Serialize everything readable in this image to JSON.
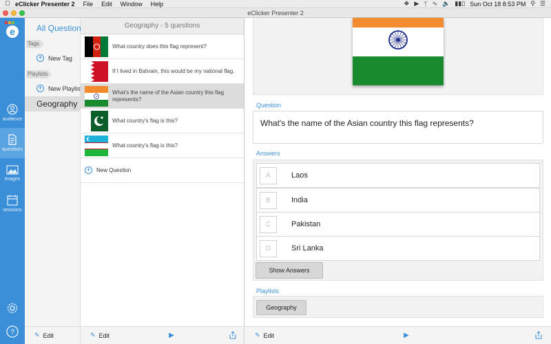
{
  "menubar": {
    "app_name": "eClicker Presenter 2",
    "menus": [
      "File",
      "Edit",
      "Window",
      "Help"
    ],
    "clock": "Sun Oct 18  8:53 PM"
  },
  "window": {
    "title": "eClicker Presenter 2"
  },
  "rail": {
    "items": [
      {
        "label": "audience",
        "icon": "person-icon"
      },
      {
        "label": "questions",
        "icon": "document-icon"
      },
      {
        "label": "images",
        "icon": "image-icon"
      },
      {
        "label": "sessions",
        "icon": "calendar-icon"
      }
    ],
    "accent": "#3a8fd8"
  },
  "library": {
    "all_questions": "All Questions",
    "tags_header": "Tags",
    "new_tag": "New Tag",
    "playlists_header": "Playlists",
    "new_playlist": "New Playlist",
    "selected_playlist": "Geography",
    "edit_label": "Edit"
  },
  "question_list": {
    "header": "Geography - 5 questions",
    "items": [
      {
        "text": "What country does this flag represent?",
        "flag": "afghanistan"
      },
      {
        "text": "If I lived in Bahrain, this would be my national flag.",
        "flag": "bahrain"
      },
      {
        "text": "What's the name of the Asian country this flag represents?",
        "flag": "india",
        "selected": true
      },
      {
        "text": "What country's flag is this?",
        "flag": "pakistan"
      },
      {
        "text": "What country's flag is this?",
        "flag": "uzbekistan"
      }
    ],
    "new_question": "New Question",
    "edit_label": "Edit"
  },
  "detail": {
    "question_label": "Question",
    "question_text": "What's the name of the Asian country this flag represents?",
    "answers_label": "Answers",
    "answers": [
      {
        "letter": "A",
        "text": "Laos"
      },
      {
        "letter": "B",
        "text": "India"
      },
      {
        "letter": "C",
        "text": "Pakistan"
      },
      {
        "letter": "D",
        "text": "Sri Lanka"
      }
    ],
    "show_answers": "Show Answers",
    "playlists_label": "Playlists",
    "playlist_chip": "Geography",
    "edit_label": "Edit"
  }
}
